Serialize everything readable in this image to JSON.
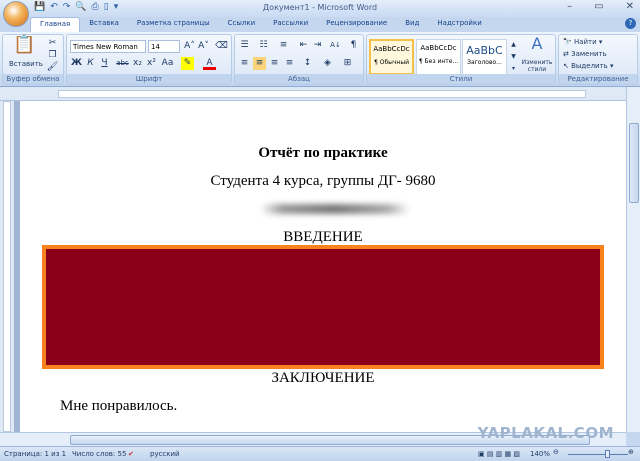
{
  "window": {
    "title": "Документ1 - Microsoft Word",
    "minimize": "–",
    "maximize": "▭",
    "close": "✕"
  },
  "qat": [
    "save-icon",
    "undo-icon",
    "redo-icon",
    "print-preview-icon",
    "print-icon",
    "new-icon",
    "customize-icon"
  ],
  "tabs": [
    "Главная",
    "Вставка",
    "Разметка страницы",
    "Ссылки",
    "Рассылки",
    "Рецензирование",
    "Вид",
    "Надстройки"
  ],
  "ribbon": {
    "clipboard": {
      "label": "Буфер обмена",
      "paste": "Вставить"
    },
    "font": {
      "label": "Шрифт",
      "name": "Times New Roman",
      "size": "14",
      "bold": "Ж",
      "italic": "К",
      "underline": "Ч",
      "strike": "abc",
      "sub": "x₂",
      "sup": "x²",
      "case": "Aa",
      "grow": "A˄",
      "shrink": "A˅",
      "color": "A"
    },
    "paragraph": {
      "label": "Абзац",
      "pilcrow": "¶",
      "sort": "А↓"
    },
    "styles": {
      "label": "Стили",
      "items": [
        {
          "preview": "AaBbCcDc",
          "name": "¶ Обычный"
        },
        {
          "preview": "AaBbCcDc",
          "name": "¶ Без инте..."
        },
        {
          "preview": "AaBbC",
          "name": "Заголово..."
        }
      ],
      "change": "Изменить стили"
    },
    "editing": {
      "label": "Редактирование",
      "find": "Найти",
      "replace": "Заменить",
      "select": "Выделить"
    }
  },
  "document": {
    "title": "Отчёт по практике",
    "subtitle": "Студента 4 курса, группы ДГ- 9680",
    "intro": "ВВЕДЕНИЕ",
    "conclusion": "ЗАКЛЮЧЕНИЕ",
    "body": "Мне понравилось.",
    "redacted_fill": "#8b0018",
    "redacted_border": "#f7821e"
  },
  "status": {
    "page": "Страница: 1 из 1",
    "words": "Число слов: 55",
    "language": "русский",
    "zoom": "140%"
  },
  "watermark": "YAPLAKAL.COM"
}
